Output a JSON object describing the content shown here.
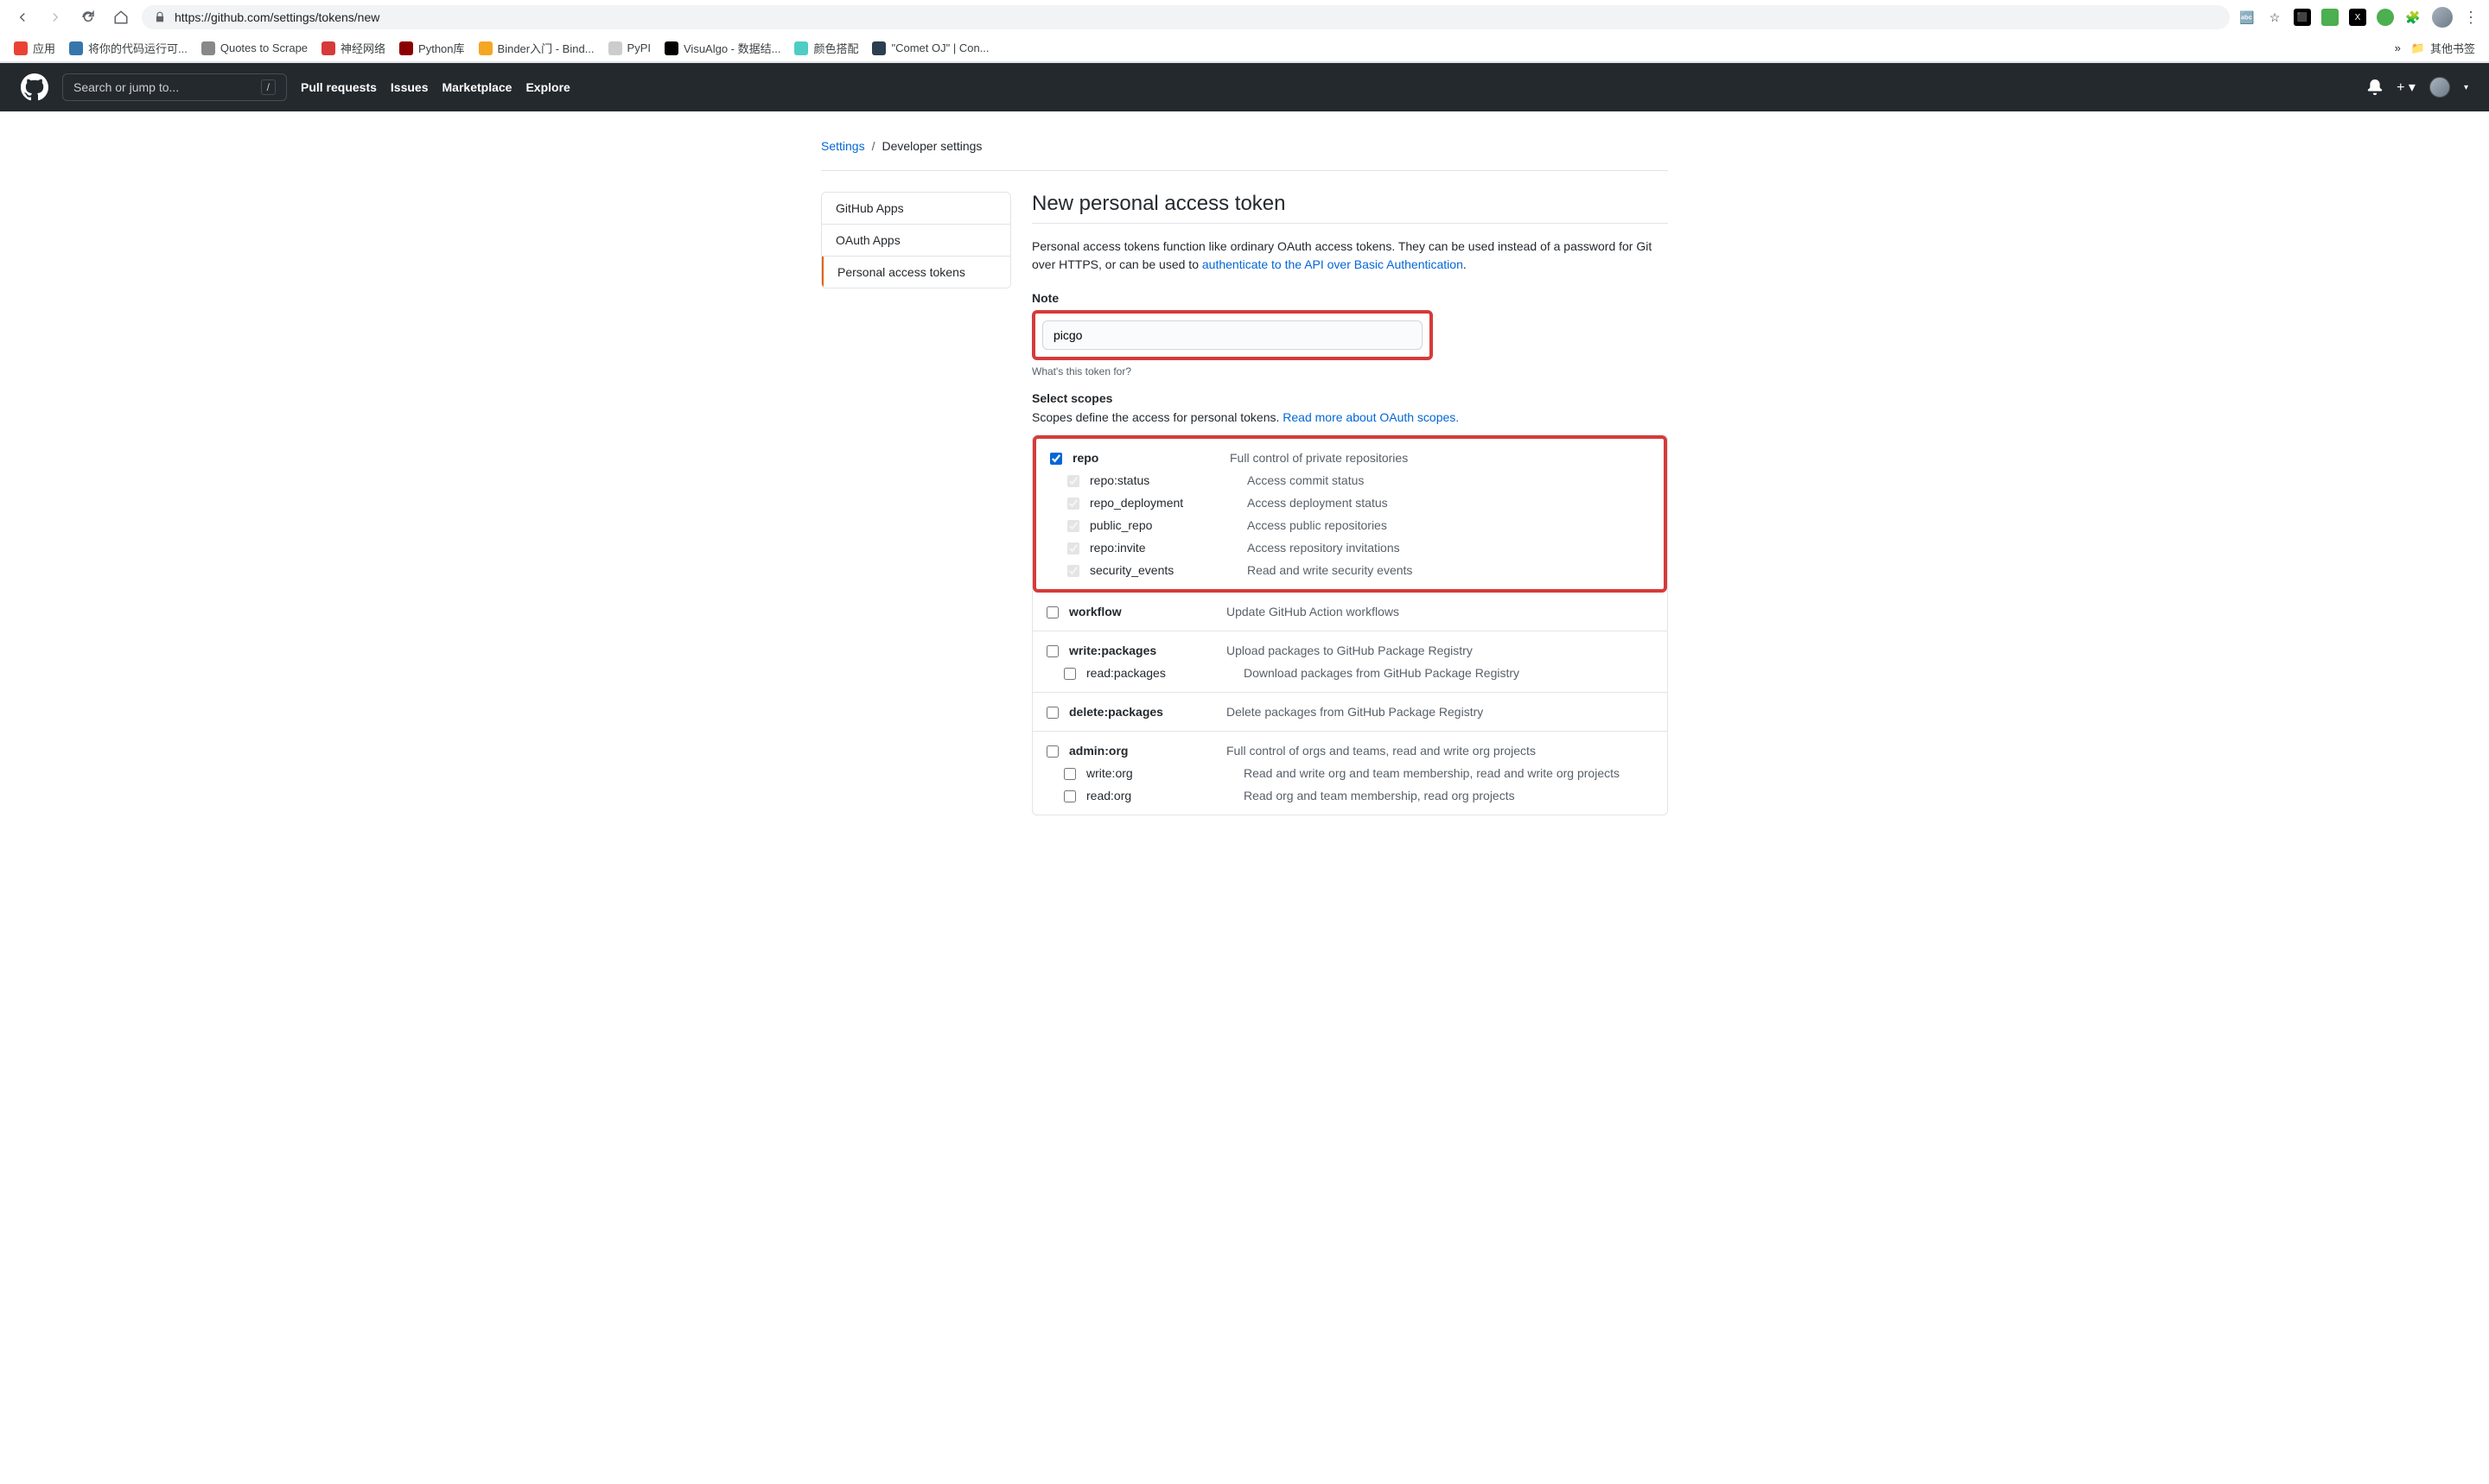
{
  "browser": {
    "url": "https://github.com/settings/tokens/new",
    "bookmarks": [
      {
        "label": "应用",
        "color": "#ea4335"
      },
      {
        "label": "将你的代码运行可...",
        "color": "#3776ab"
      },
      {
        "label": "Quotes to Scrape",
        "color": "#888"
      },
      {
        "label": "神经网络",
        "color": "#d73a3a"
      },
      {
        "label": "Python库",
        "color": "#8b0000"
      },
      {
        "label": "Binder入门 - Bind...",
        "color": "#f5a623"
      },
      {
        "label": "PyPI",
        "color": "#ccc"
      },
      {
        "label": "VisuAlgo - 数据结...",
        "color": "#000"
      },
      {
        "label": "颜色搭配",
        "color": "#4ecdc4"
      },
      {
        "label": "\"Comet OJ\" | Con...",
        "color": "#2c3e50"
      }
    ],
    "other_bookmarks": "其他书签"
  },
  "gh_header": {
    "search_placeholder": "Search or jump to...",
    "nav": [
      "Pull requests",
      "Issues",
      "Marketplace",
      "Explore"
    ]
  },
  "breadcrumbs": {
    "root": "Settings",
    "current": "Developer settings"
  },
  "sidebar": {
    "items": [
      "GitHub Apps",
      "OAuth Apps",
      "Personal access tokens"
    ]
  },
  "page": {
    "title": "New personal access token",
    "intro_prefix": "Personal access tokens function like ordinary OAuth access tokens. They can be used instead of a password for Git over HTTPS, or can be used to ",
    "intro_link": "authenticate to the API over Basic Authentication",
    "intro_suffix": ".",
    "note_label": "Note",
    "note_value": "picgo",
    "note_hint": "What's this token for?",
    "scopes_heading": "Select scopes",
    "scopes_intro_prefix": "Scopes define the access for personal tokens. ",
    "scopes_intro_link": "Read more about OAuth scopes."
  },
  "scopes": [
    {
      "name": "repo",
      "desc": "Full control of private repositories",
      "checked": true,
      "highlight": true,
      "children": [
        {
          "name": "repo:status",
          "desc": "Access commit status",
          "checked": true,
          "disabled": true
        },
        {
          "name": "repo_deployment",
          "desc": "Access deployment status",
          "checked": true,
          "disabled": true
        },
        {
          "name": "public_repo",
          "desc": "Access public repositories",
          "checked": true,
          "disabled": true
        },
        {
          "name": "repo:invite",
          "desc": "Access repository invitations",
          "checked": true,
          "disabled": true
        },
        {
          "name": "security_events",
          "desc": "Read and write security events",
          "checked": true,
          "disabled": true
        }
      ]
    },
    {
      "name": "workflow",
      "desc": "Update GitHub Action workflows",
      "checked": false,
      "children": []
    },
    {
      "name": "write:packages",
      "desc": "Upload packages to GitHub Package Registry",
      "checked": false,
      "children": [
        {
          "name": "read:packages",
          "desc": "Download packages from GitHub Package Registry",
          "checked": false
        }
      ]
    },
    {
      "name": "delete:packages",
      "desc": "Delete packages from GitHub Package Registry",
      "checked": false,
      "children": []
    },
    {
      "name": "admin:org",
      "desc": "Full control of orgs and teams, read and write org projects",
      "checked": false,
      "children": [
        {
          "name": "write:org",
          "desc": "Read and write org and team membership, read and write org projects",
          "checked": false
        },
        {
          "name": "read:org",
          "desc": "Read org and team membership, read org projects",
          "checked": false
        }
      ]
    }
  ]
}
